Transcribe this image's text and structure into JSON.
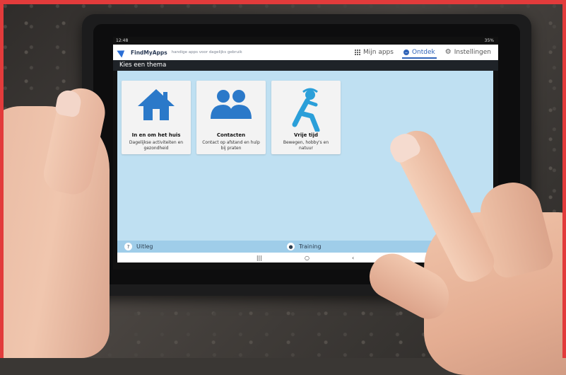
{
  "status": {
    "time": "12:48",
    "battery": "35%"
  },
  "app": {
    "name": "FindMyApps",
    "tagline": "handige apps voor dagelijks gebruik"
  },
  "nav": {
    "items": [
      {
        "label": "Mijn apps",
        "icon": "grid-icon",
        "active": false
      },
      {
        "label": "Ontdek",
        "icon": "compass-icon",
        "active": true
      },
      {
        "label": "Instellingen",
        "icon": "gear-icon",
        "active": false
      }
    ]
  },
  "section_title": "Kies een thema",
  "themes": [
    {
      "title": "In en om het huis",
      "description": "Dagelijkse activiteiten en gezondheid",
      "icon": "house-icon"
    },
    {
      "title": "Contacten",
      "description": "Contact op afstand en hulp bij praten",
      "icon": "people-icon"
    },
    {
      "title": "Vrije tijd",
      "description": "Bewegen, hobby's en natuur",
      "icon": "relaxing-person-icon"
    }
  ],
  "bottom": {
    "left_label": "Uitleg",
    "center_label": "Training"
  },
  "system_nav": {
    "recents": "|||",
    "home": "○",
    "back": "‹"
  },
  "colors": {
    "accent": "#2f63b8",
    "icon_blue": "#2b79c9",
    "content_bg": "#bfe0f2",
    "border_red": "#e23b3b"
  }
}
